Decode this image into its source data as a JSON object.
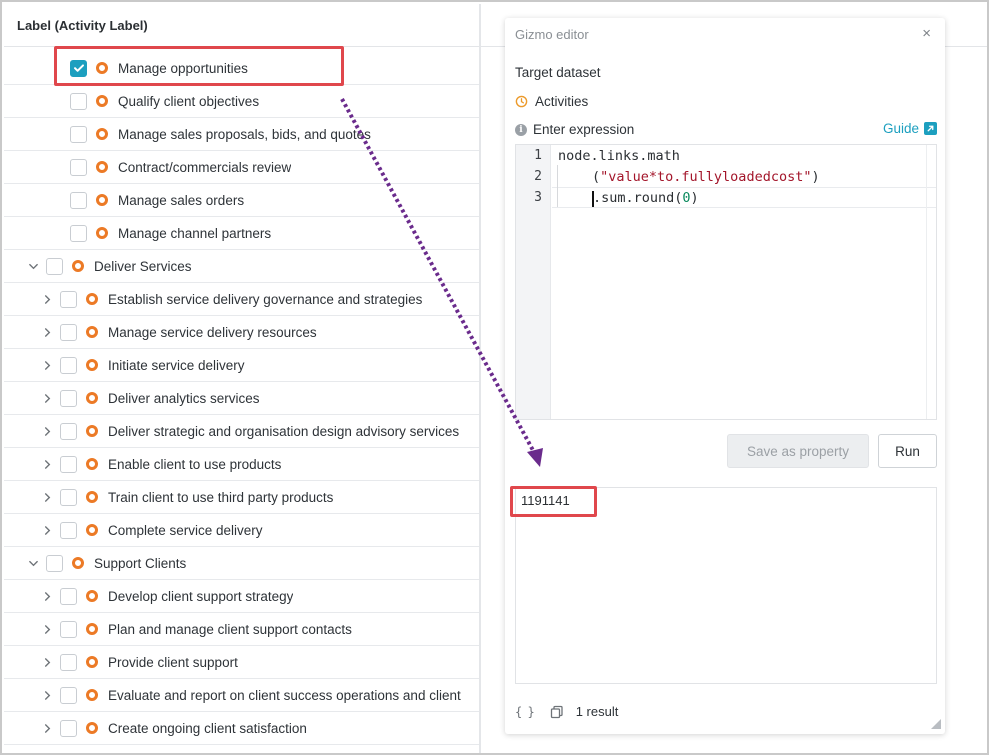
{
  "tree": {
    "header": "Label (Activity Label)",
    "rows": [
      {
        "label": "Manage opportunities",
        "level": 2,
        "checked": true,
        "expandable": false
      },
      {
        "label": "Qualify client objectives",
        "level": 2,
        "checked": false,
        "expandable": false
      },
      {
        "label": "Manage sales proposals, bids, and quotes",
        "level": 2,
        "checked": false,
        "expandable": false
      },
      {
        "label": "Contract/commercials review",
        "level": 2,
        "checked": false,
        "expandable": false
      },
      {
        "label": "Manage sales orders",
        "level": 2,
        "checked": false,
        "expandable": false
      },
      {
        "label": "Manage channel partners",
        "level": 2,
        "checked": false,
        "expandable": false
      },
      {
        "label": "Deliver Services",
        "level": 0,
        "checked": false,
        "expandable": true,
        "expanded": true
      },
      {
        "label": "Establish service delivery governance and strategies",
        "level": 1,
        "checked": false,
        "expandable": true,
        "expanded": false
      },
      {
        "label": "Manage service delivery resources",
        "level": 1,
        "checked": false,
        "expandable": true,
        "expanded": false
      },
      {
        "label": "Initiate service delivery",
        "level": 1,
        "checked": false,
        "expandable": true,
        "expanded": false
      },
      {
        "label": "Deliver analytics services",
        "level": 1,
        "checked": false,
        "expandable": true,
        "expanded": false
      },
      {
        "label": "Deliver strategic and organisation design advisory services",
        "level": 1,
        "checked": false,
        "expandable": true,
        "expanded": false
      },
      {
        "label": "Enable client to use products",
        "level": 1,
        "checked": false,
        "expandable": true,
        "expanded": false
      },
      {
        "label": "Train client to use third party products",
        "level": 1,
        "checked": false,
        "expandable": true,
        "expanded": false
      },
      {
        "label": "Complete service delivery",
        "level": 1,
        "checked": false,
        "expandable": true,
        "expanded": false
      },
      {
        "label": "Support Clients",
        "level": 0,
        "checked": false,
        "expandable": true,
        "expanded": true
      },
      {
        "label": "Develop client support strategy",
        "level": 1,
        "checked": false,
        "expandable": true,
        "expanded": false
      },
      {
        "label": "Plan and manage client support contacts",
        "level": 1,
        "checked": false,
        "expandable": true,
        "expanded": false
      },
      {
        "label": "Provide client support",
        "level": 1,
        "checked": false,
        "expandable": true,
        "expanded": false
      },
      {
        "label": "Evaluate and report on client success operations and client",
        "level": 1,
        "checked": false,
        "expandable": true,
        "expanded": false
      },
      {
        "label": "Create ongoing client satisfaction",
        "level": 1,
        "checked": false,
        "expandable": true,
        "expanded": false
      }
    ]
  },
  "editor": {
    "title": "Gizmo editor",
    "close": "×",
    "target_label": "Target dataset",
    "dataset": "Activities",
    "expression_label": "Enter expression",
    "guide": "Guide",
    "code": {
      "line_numbers": [
        "1",
        "2",
        "3"
      ],
      "line1": "node.links.math",
      "line2_open": "(",
      "line2_string": "\"value*to.fullyloadedcost\"",
      "line2_close": ")",
      "line3_pre": ".sum.round(",
      "line3_num": "0",
      "line3_post": ")"
    },
    "save_button": "Save as property",
    "run_button": "Run",
    "result_value": "1191141",
    "footer_braces": "{ }",
    "result_count": "1 result"
  },
  "colors": {
    "accent": "#1c9fbf",
    "activity_ring": "#ec7a26",
    "highlight": "#e0474c",
    "arrow": "#6a2b8c"
  }
}
